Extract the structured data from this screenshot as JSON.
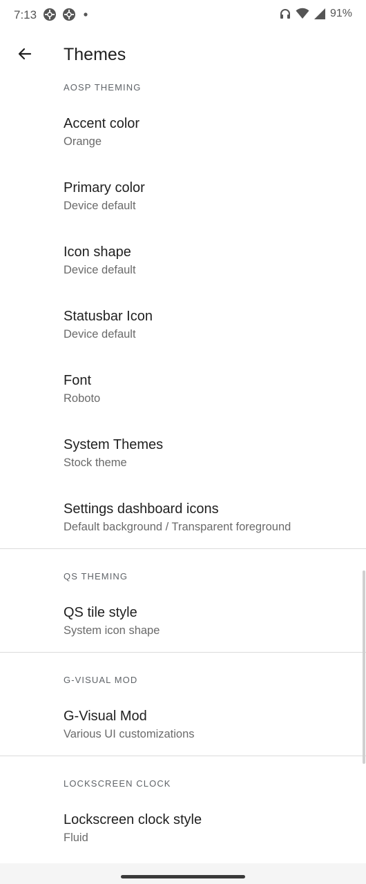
{
  "status_bar": {
    "time": "7:13",
    "battery": "91%"
  },
  "app_bar": {
    "title": "Themes"
  },
  "sections": [
    {
      "header": "AOSP THEMING",
      "items": [
        {
          "title": "Accent color",
          "summary": "Orange"
        },
        {
          "title": "Primary color",
          "summary": "Device default"
        },
        {
          "title": "Icon shape",
          "summary": "Device default"
        },
        {
          "title": "Statusbar Icon",
          "summary": "Device default"
        },
        {
          "title": "Font",
          "summary": "Roboto"
        },
        {
          "title": "System Themes",
          "summary": "Stock theme"
        },
        {
          "title": "Settings dashboard icons",
          "summary": "Default background / Transparent foreground"
        }
      ]
    },
    {
      "header": "QS THEMING",
      "items": [
        {
          "title": "QS tile style",
          "summary": "System icon shape"
        }
      ]
    },
    {
      "header": "G-VISUAL MOD",
      "items": [
        {
          "title": "G-Visual Mod",
          "summary": "Various UI customizations"
        }
      ]
    },
    {
      "header": "LOCKSCREEN CLOCK",
      "items": [
        {
          "title": "Lockscreen clock style",
          "summary": "Fluid"
        }
      ]
    }
  ]
}
